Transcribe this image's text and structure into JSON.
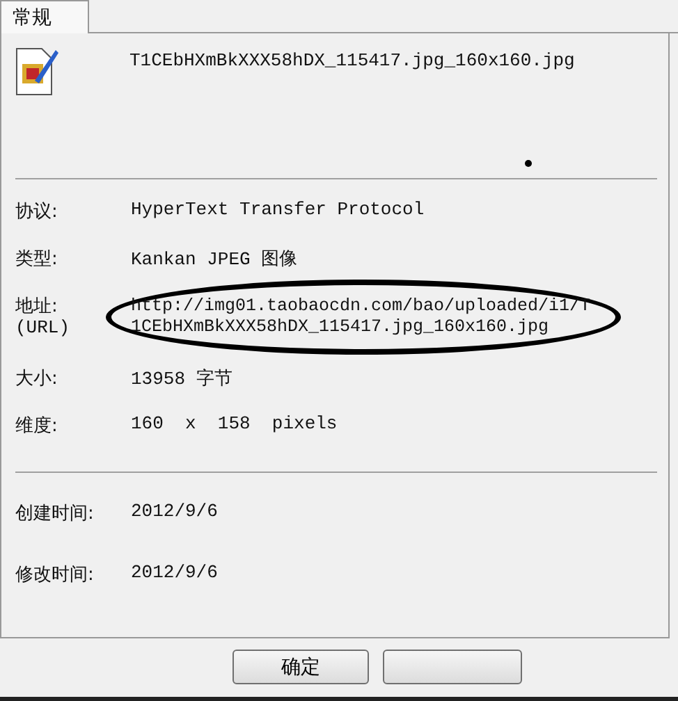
{
  "tabs": [
    {
      "label": "常规",
      "selected": true
    }
  ],
  "file": {
    "name": "T1CEbHXmBkXXX58hDX_115417.jpg_160x160.jpg"
  },
  "properties": [
    {
      "label": "协议:",
      "value": "HyperText Transfer Protocol"
    },
    {
      "label": "类型:",
      "value": "Kankan JPEG 图像"
    },
    {
      "label": "地址:",
      "sublabel": "(URL)",
      "value": "http://img01.taobaocdn.com/bao/uploaded/i1/T1CEbHXmBkXXX58hDX_115417.jpg_160x160.jpg"
    },
    {
      "label": "大小:",
      "value": "13958 字节"
    },
    {
      "label": "维度:",
      "value": "160  x  158  pixels"
    }
  ],
  "dates": [
    {
      "label": "创建时间:",
      "value": "2012/9/6"
    },
    {
      "label": "修改时间:",
      "value": "2012/9/6"
    }
  ],
  "buttons": [
    "确定"
  ]
}
